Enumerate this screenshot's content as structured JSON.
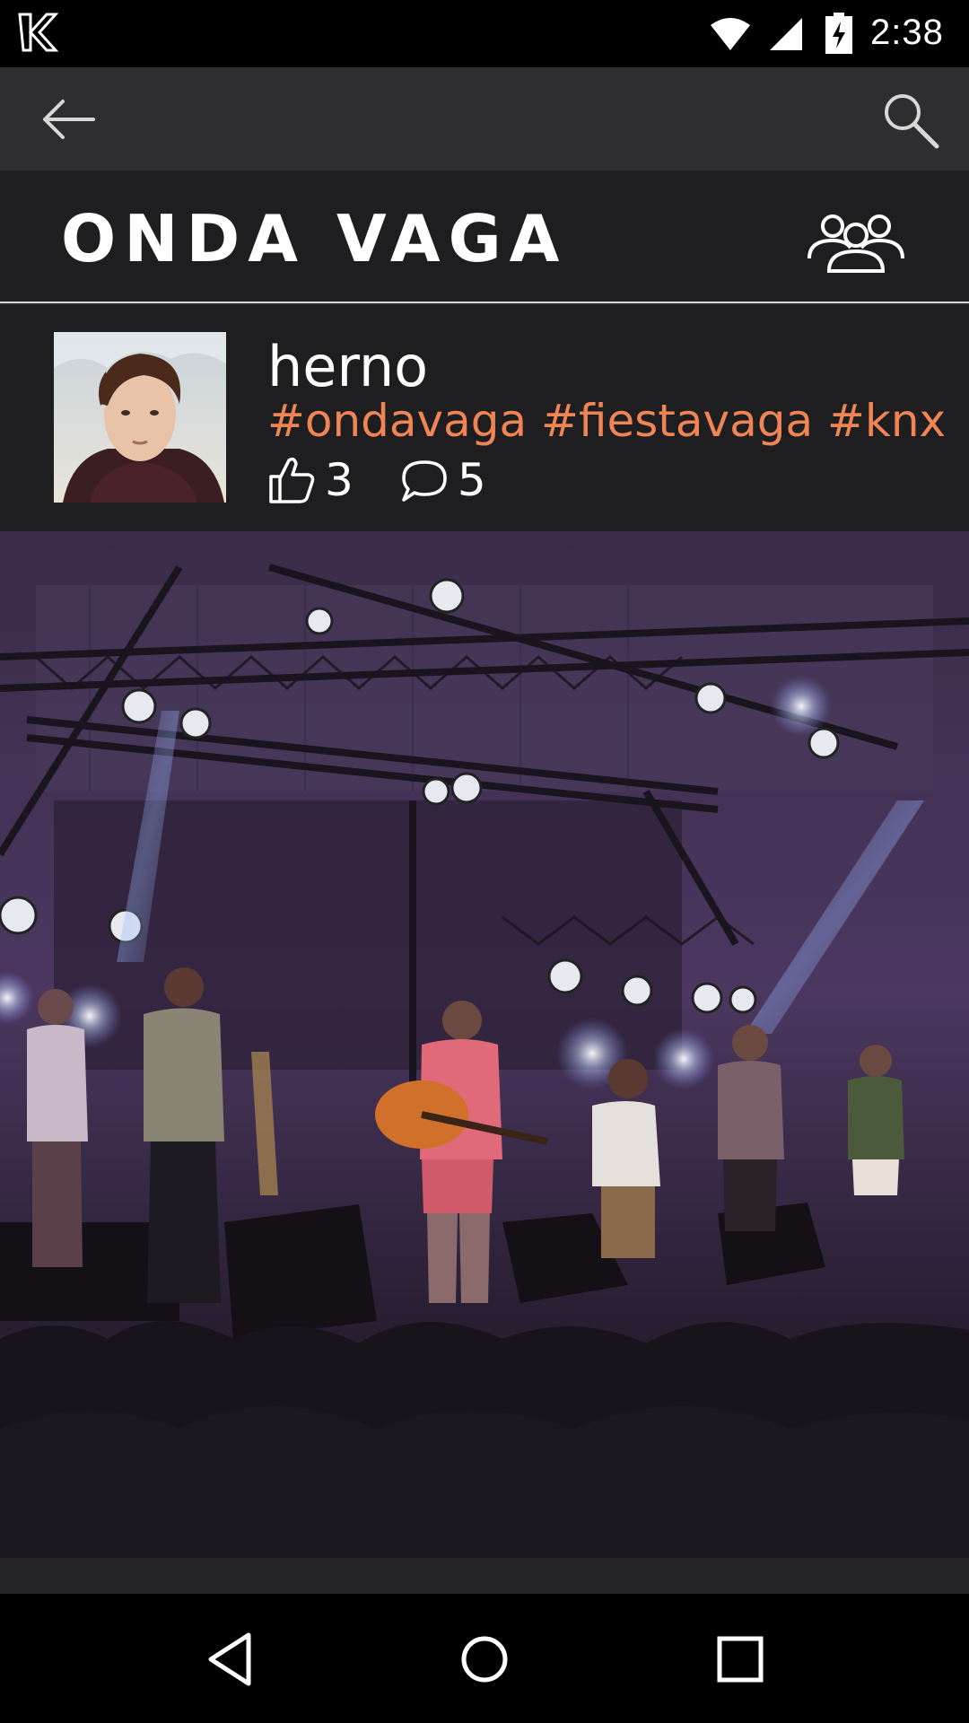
{
  "status_bar": {
    "time": "2:38",
    "icons": [
      "app-logo-icon",
      "wifi-icon",
      "signal-icon",
      "battery-charging-icon"
    ]
  },
  "toolbar": {
    "icons": [
      "back-arrow-icon",
      "search-icon"
    ]
  },
  "group": {
    "title": "ONDA VAGA",
    "members_icon": "group-members-icon"
  },
  "post": {
    "username": "herno",
    "hashtags": "#ondavaga #fiestavaga #knx",
    "likes": "3",
    "comments": "5",
    "like_icon": "thumbs-up-icon",
    "comment_icon": "comment-icon"
  },
  "nav_bar": {
    "icons": [
      "nav-back-icon",
      "nav-home-icon",
      "nav-recents-icon"
    ]
  },
  "colors": {
    "accent": "#ef8454",
    "header_bg": "#1e1e20",
    "toolbar_bg": "#2e2e30",
    "status_bg": "#000000"
  }
}
